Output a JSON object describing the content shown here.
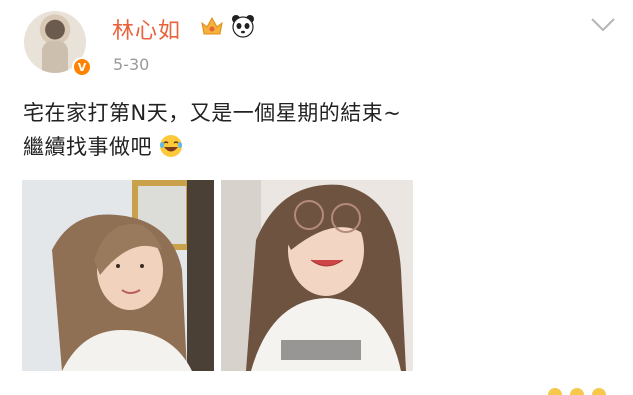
{
  "post": {
    "username": "林心如",
    "date": "5-30",
    "verified_badge": "V",
    "text_line1": "宅在家打第N天，又是一個星期的結束~",
    "text_line2": "繼續找事做吧",
    "icons": [
      "crown-icon",
      "panda-icon",
      "chevron-down-icon",
      "laughing-emoji-icon"
    ],
    "colors": {
      "username": "#e8633c",
      "badge": "#ff8200",
      "date": "#9a9a9a"
    }
  }
}
